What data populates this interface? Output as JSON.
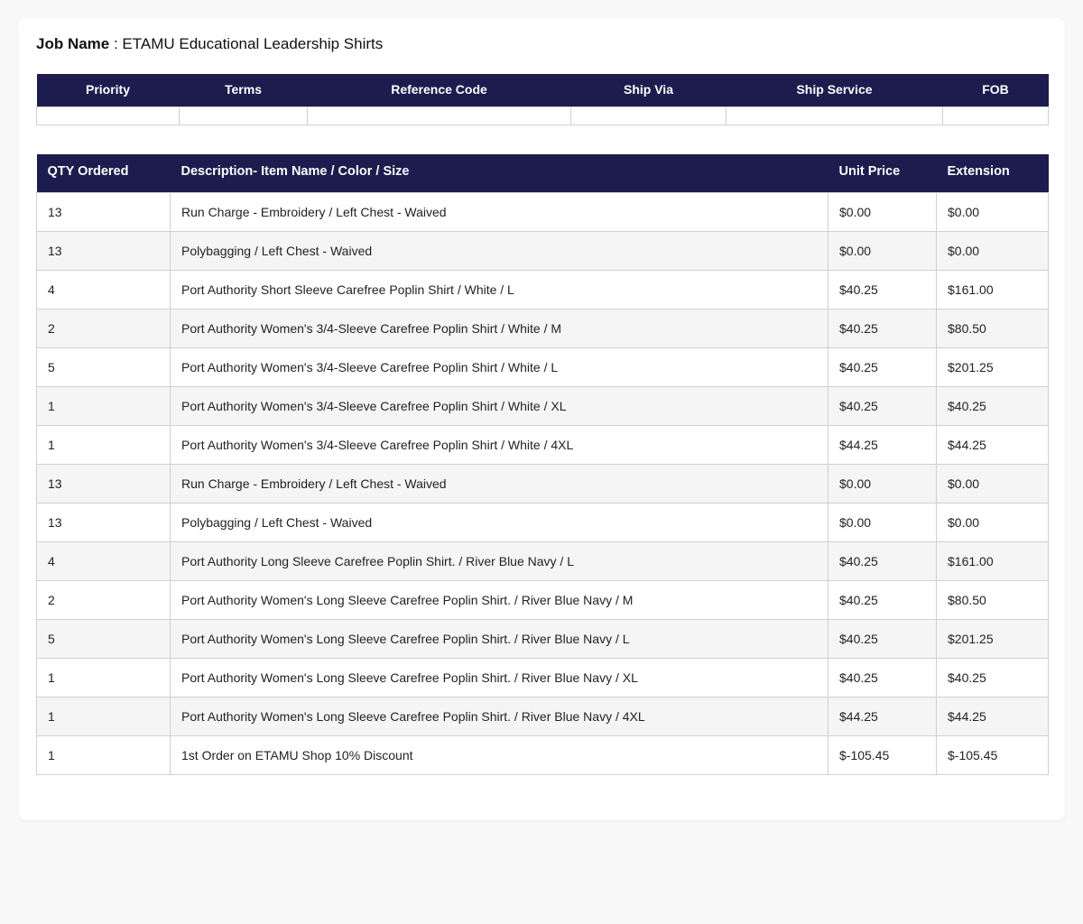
{
  "job": {
    "label": "Job Name",
    "separator": " : ",
    "value": "ETAMU Educational Leadership Shirts"
  },
  "shipping": {
    "headers": [
      "Priority",
      "Terms",
      "Reference Code",
      "Ship Via",
      "Ship Service",
      "FOB"
    ],
    "values": [
      "",
      "",
      "",
      "",
      "",
      ""
    ]
  },
  "items": {
    "headers": [
      "QTY Ordered",
      "Description- Item Name / Color / Size",
      "Unit Price",
      "Extension"
    ],
    "rows": [
      {
        "qty": "13",
        "description": "Run Charge - Embroidery / Left Chest - Waived",
        "unit_price": "$0.00",
        "extension": "$0.00"
      },
      {
        "qty": "13",
        "description": "Polybagging / Left Chest - Waived",
        "unit_price": "$0.00",
        "extension": "$0.00"
      },
      {
        "qty": "4",
        "description": "Port Authority Short Sleeve Carefree Poplin Shirt / White / L",
        "unit_price": "$40.25",
        "extension": "$161.00"
      },
      {
        "qty": "2",
        "description": "Port Authority Women's 3/4-Sleeve Carefree Poplin Shirt / White / M",
        "unit_price": "$40.25",
        "extension": "$80.50"
      },
      {
        "qty": "5",
        "description": "Port Authority Women's 3/4-Sleeve Carefree Poplin Shirt / White / L",
        "unit_price": "$40.25",
        "extension": "$201.25"
      },
      {
        "qty": "1",
        "description": "Port Authority Women's 3/4-Sleeve Carefree Poplin Shirt / White / XL",
        "unit_price": "$40.25",
        "extension": "$40.25"
      },
      {
        "qty": "1",
        "description": "Port Authority Women's 3/4-Sleeve Carefree Poplin Shirt / White / 4XL",
        "unit_price": "$44.25",
        "extension": "$44.25"
      },
      {
        "qty": "13",
        "description": "Run Charge - Embroidery / Left Chest - Waived",
        "unit_price": "$0.00",
        "extension": "$0.00"
      },
      {
        "qty": "13",
        "description": "Polybagging / Left Chest - Waived",
        "unit_price": "$0.00",
        "extension": "$0.00"
      },
      {
        "qty": "4",
        "description": "Port Authority Long Sleeve Carefree Poplin Shirt. / River Blue Navy / L",
        "unit_price": "$40.25",
        "extension": "$161.00"
      },
      {
        "qty": "2",
        "description": "Port Authority Women's Long Sleeve Carefree Poplin Shirt. / River Blue Navy / M",
        "unit_price": "$40.25",
        "extension": "$80.50"
      },
      {
        "qty": "5",
        "description": "Port Authority Women's Long Sleeve Carefree Poplin Shirt. / River Blue Navy / L",
        "unit_price": "$40.25",
        "extension": "$201.25"
      },
      {
        "qty": "1",
        "description": "Port Authority Women's Long Sleeve Carefree Poplin Shirt. / River Blue Navy / XL",
        "unit_price": "$40.25",
        "extension": "$40.25"
      },
      {
        "qty": "1",
        "description": "Port Authority Women's Long Sleeve Carefree Poplin Shirt. / River Blue Navy / 4XL",
        "unit_price": "$44.25",
        "extension": "$44.25"
      },
      {
        "qty": "1",
        "description": "1st Order on ETAMU Shop 10% Discount",
        "unit_price": "$-105.45",
        "extension": "$-105.45"
      }
    ]
  },
  "colors": {
    "header_bg": "#1c1c4e",
    "header_text": "#ffffff",
    "row_alt_bg": "#f5f5f5",
    "page_bg": "#f8f8f8"
  }
}
